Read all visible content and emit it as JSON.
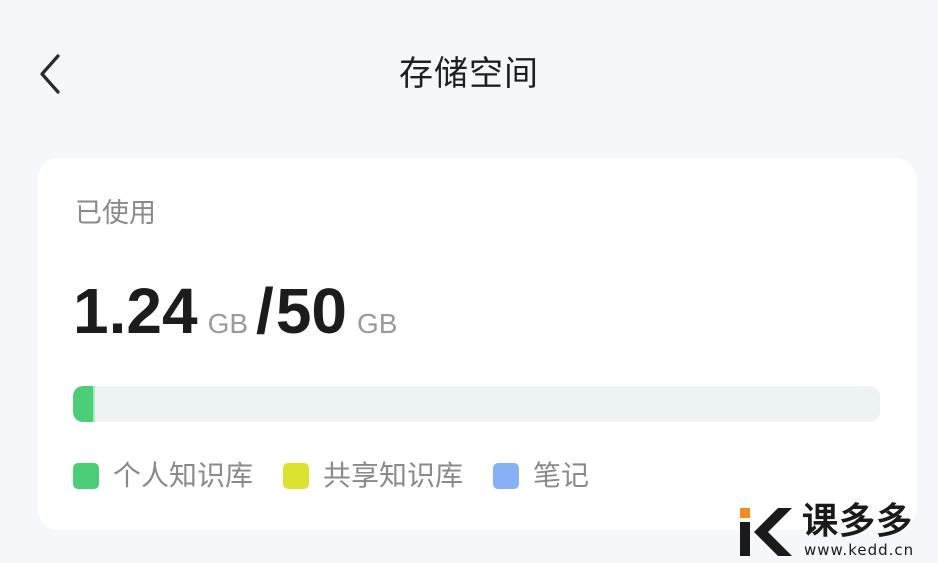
{
  "header": {
    "title": "存储空间",
    "back_icon": "chevron-left-icon"
  },
  "usage": {
    "label": "已使用",
    "used_value": "1.24",
    "used_unit": "GB",
    "separator": "/",
    "total_value": "50",
    "total_unit": "GB",
    "progress_fraction": 0.0248
  },
  "legend": [
    {
      "label": "个人知识库",
      "color": "#4cce78"
    },
    {
      "label": "共享知识库",
      "color": "#d9e22e"
    },
    {
      "label": "笔记",
      "color": "#86b1f7"
    }
  ],
  "colors": {
    "background": "#f6f7fb",
    "card": "#ffffff",
    "track": "#edf2f2",
    "fill": "#4cce78"
  },
  "watermark": {
    "brand": "课多多",
    "url": "www.kedd.cn"
  }
}
